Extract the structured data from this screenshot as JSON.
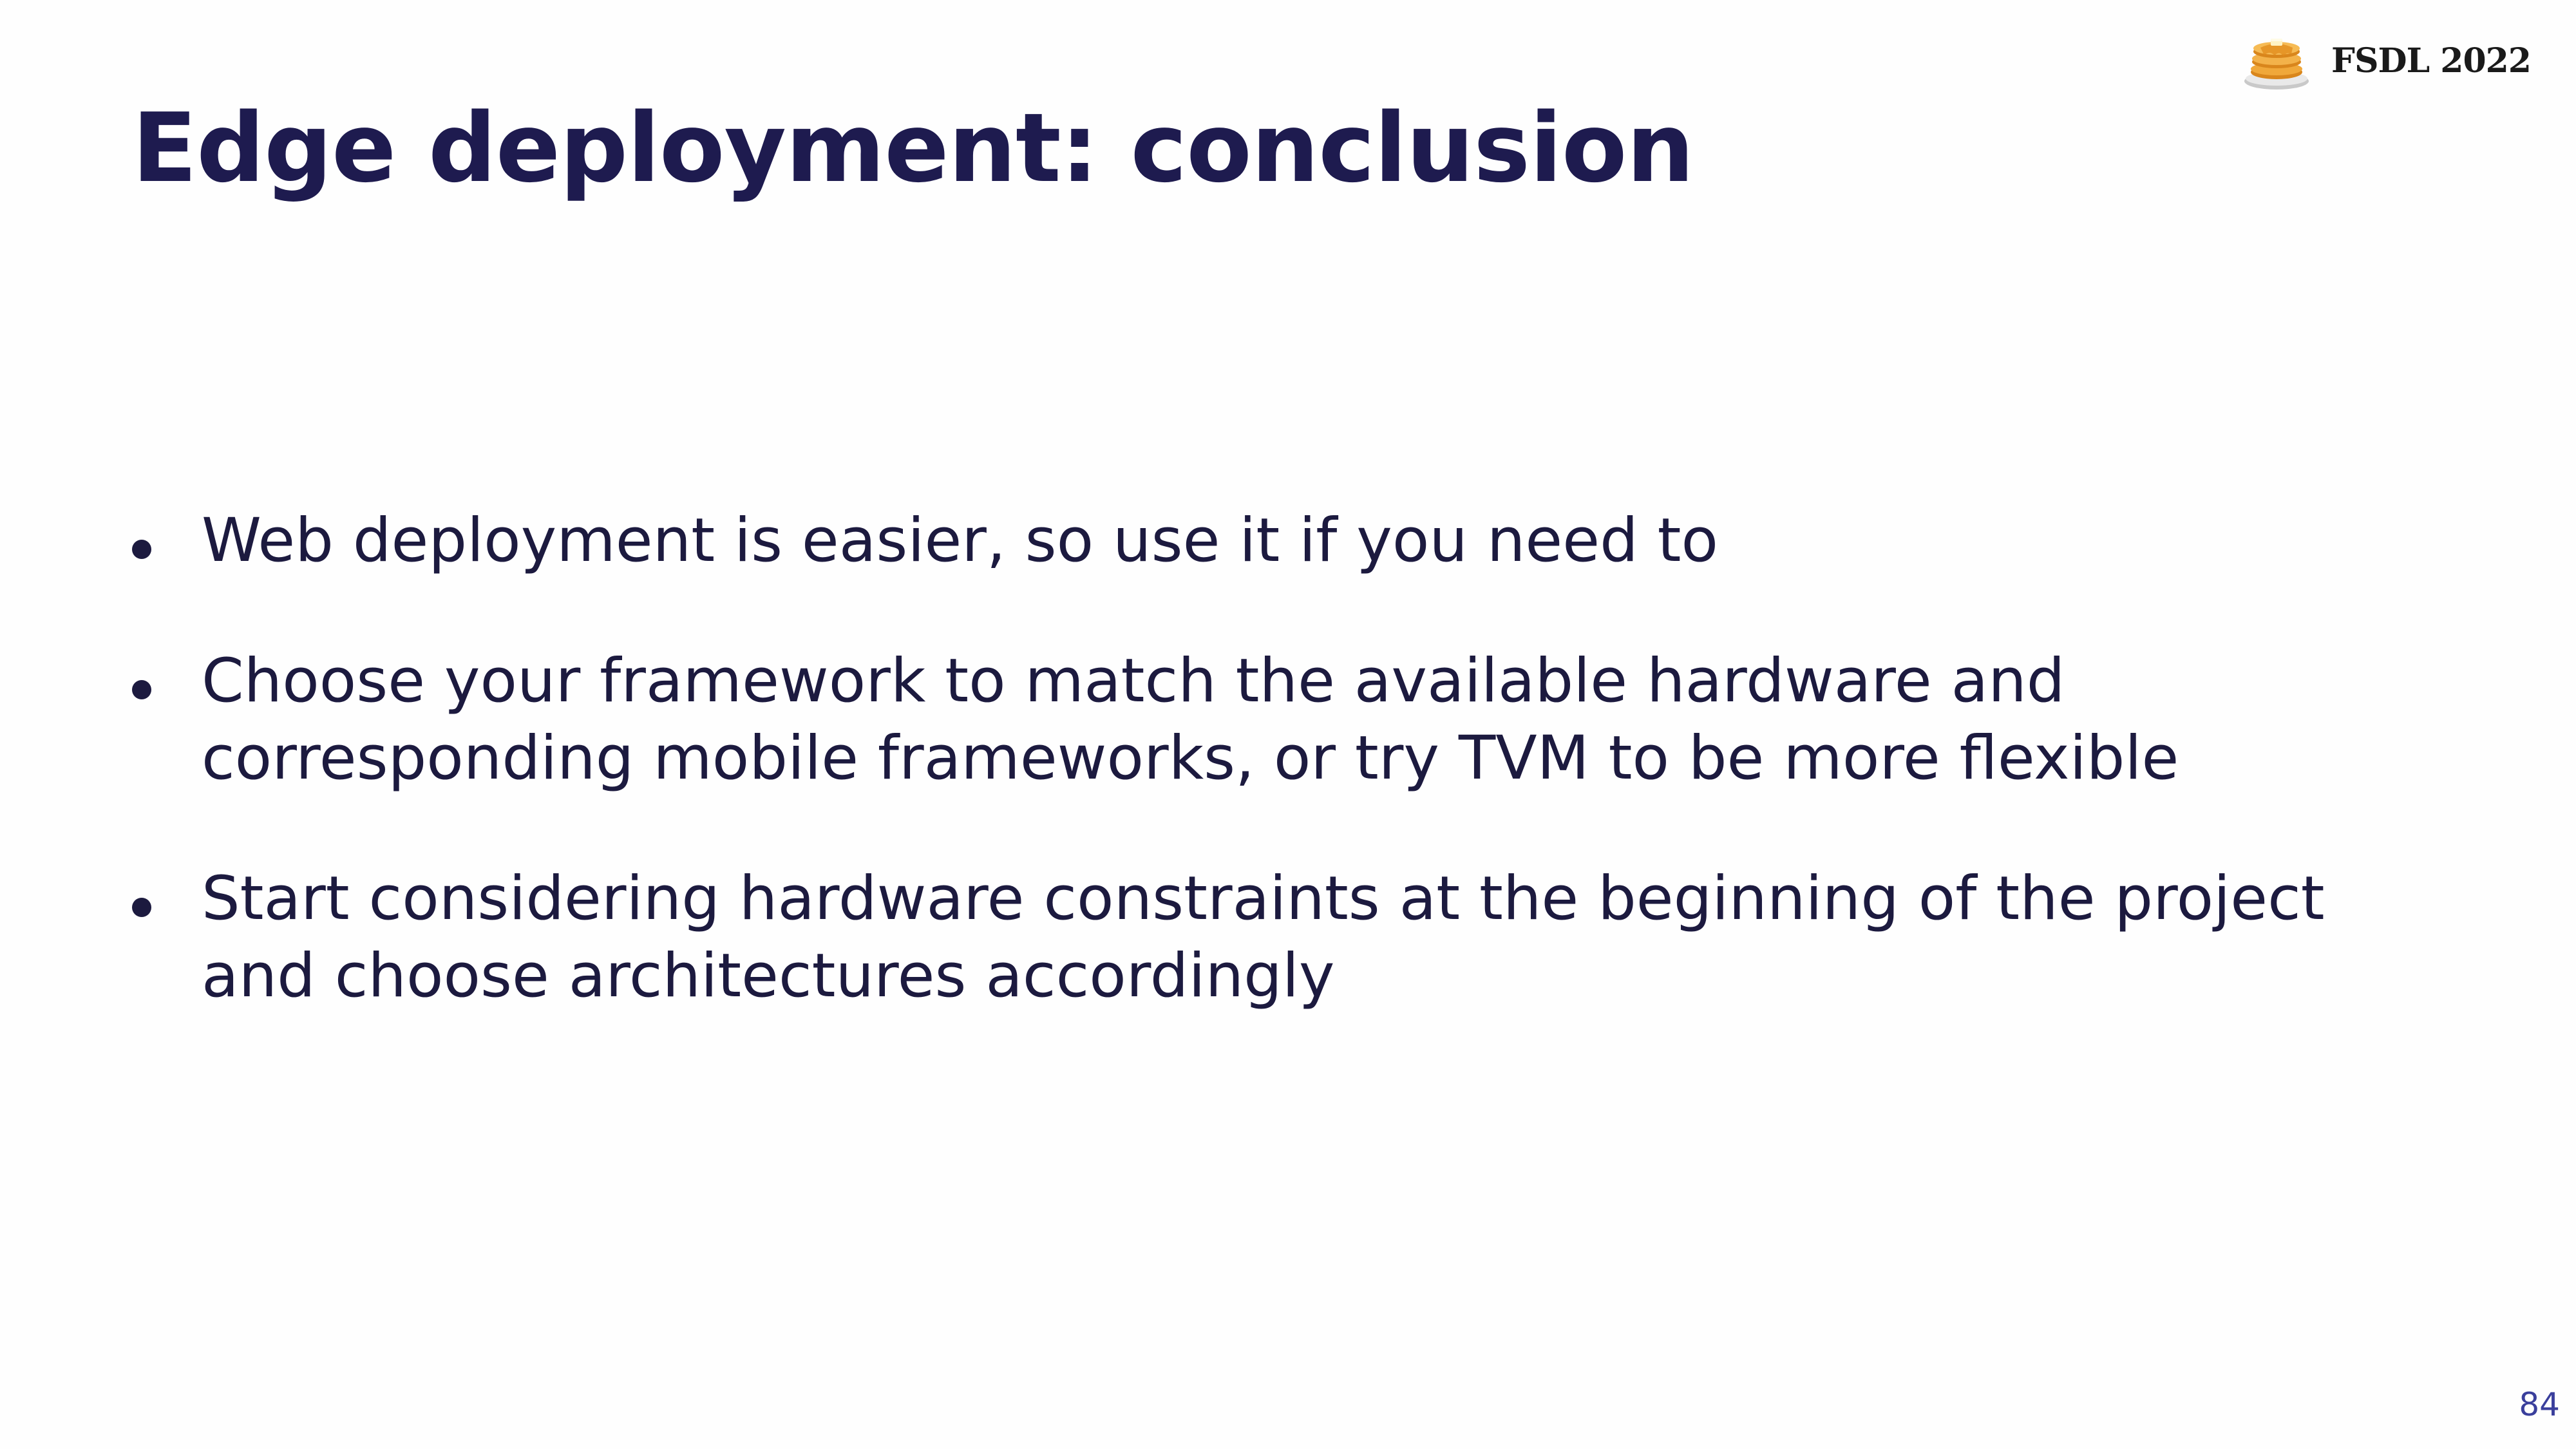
{
  "slide": {
    "title": "Edge deployment: conclusion",
    "brand": {
      "icon": "pancake-stack-icon",
      "text": "FSDL 2022"
    },
    "bullets": [
      {
        "text": "Web deployment is easier, so use it if you need to"
      },
      {
        "text": "Choose your framework to match the available hardware and corresponding mobile frameworks, or try TVM to be more flexible"
      },
      {
        "text": "Start considering hardware constraints at the beginning of the project and choose architectures accordingly"
      }
    ],
    "page_number": "84"
  },
  "colors": {
    "title": "#1e1b4f",
    "body_text": "#1c1a3f",
    "page_number": "#3a3f9c",
    "background": "#fefefe"
  }
}
